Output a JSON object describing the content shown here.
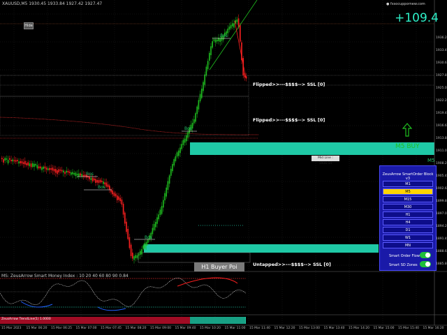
{
  "header": {
    "symbol": "XAUUSD,M5 1930.45 1933.84 1927.42 1927.47",
    "site": "● fxsocuppornew.com",
    "hide_label": "Hide",
    "big_value": "+109.4"
  },
  "labels": {
    "flip1": "Flipped>>---$$$$--> SSL [0]",
    "flip2": "Flipped>>---$$$$--> SSL [0]",
    "h1_buyer": "H1 Buyer Poi",
    "untapped": "Untapped>>---$$$$--> SSL [0]",
    "mid_line": "Mid Line : 1906.14",
    "m5_buy": "M5 BUY",
    "m5_small": "M5"
  },
  "panel": {
    "title": "ZeusArrow SmartOrder Block v3",
    "timeframes": [
      "M1",
      "M5",
      "M15",
      "M30",
      "H1",
      "H4",
      "D1",
      "W1",
      "MN"
    ],
    "selected": "M5",
    "toggles": [
      {
        "label": "Smart Order Flow",
        "on": true
      },
      {
        "label": "Smart SD Zones",
        "on": true
      }
    ]
  },
  "indicator": {
    "title": "MS: ZeusArrow Smart Money Index : 10 20 40 60 80 90 0.84",
    "bottom_label": "ZeusArrow TrendLine(1) 1.0000"
  },
  "time_axis": [
    "15 Mar 2023",
    "15 Mar 06:20",
    "15 Mar 06:25",
    "15 Mar 07:00",
    "15 Mar 07:45",
    "15 Mar 08:20",
    "15 Mar 09:00",
    "15 Mar 09:40",
    "15 Mar 10:20",
    "15 Mar 11:00",
    "15 Mar 11:40",
    "15 Mar 12:20",
    "15 Mar 13:00",
    "15 Mar 13:40",
    "15 Mar 14:20",
    "15 Mar 15:00",
    "15 Mar 15:40",
    "15 Mar 16:20"
  ],
  "price_axis": [
    "1936.25",
    "1933.45",
    "1930.65",
    "1927.85",
    "1925.05",
    "1922.25",
    "1919.45",
    "1916.65",
    "1913.85",
    "1911.05",
    "1908.25",
    "1905.45",
    "1902.65",
    "1899.85",
    "1897.05",
    "1894.25",
    "1891.45",
    "1888.65",
    "1885.85"
  ],
  "bos_labels": [
    "Bos",
    "Bos",
    "Bos",
    "Bos",
    "Bos"
  ],
  "colors": {
    "bull": "#1fbf1f",
    "bear": "#ff2020",
    "zone": "#1fc9a6",
    "panel": "#1a1aa8"
  }
}
